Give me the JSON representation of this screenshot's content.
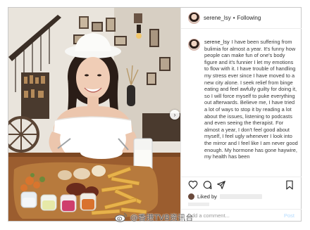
{
  "header": {
    "username": "serene_lsy",
    "separator": "•",
    "follow_status": "Following"
  },
  "caption": {
    "username": "serene_lsy",
    "text": "I have been suffering from bulimia for almost a year. It's funny how people can make fun of one's body figure and it's funnier I let my emotions to flow with it. I have trouble of handling my stress ever since I have moved to a new city alone. I seek relief from binge eating and feel awfully guilty for doing it, so I will force myself to puke everything out afterwards. Believe me, I have tried a lot of ways to stop it by reading a lot about the issues, listening to podcasts and even seeing the therapist. For almost a year, I don't feel good about myself, I feel ugly whenever I look into the mirror and I feel like I am never good enough. My hormone has gone haywire, my health has been"
  },
  "likes": {
    "label": "Liked by"
  },
  "comment": {
    "placeholder": "Add a comment...",
    "post_label": "Post"
  },
  "watermark": {
    "text": "@香港TVB资讯台"
  },
  "icons": {
    "like": "heart-icon",
    "comment": "comment-icon",
    "share": "share-icon",
    "save": "bookmark-icon",
    "next": "chevron-right-icon",
    "watermark_logo": "weibo-icon"
  }
}
